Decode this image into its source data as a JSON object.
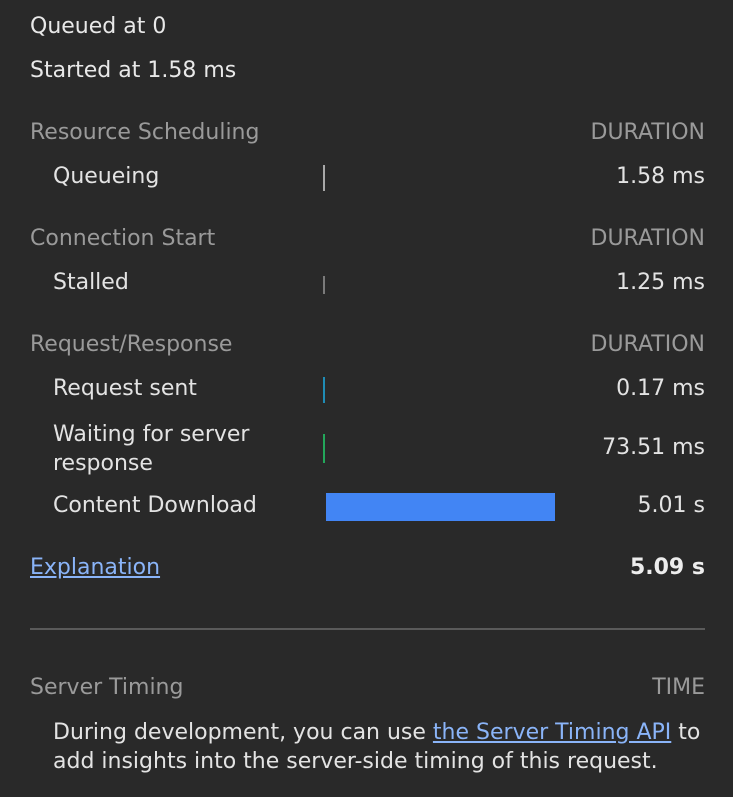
{
  "meta": {
    "queued": "Queued at 0",
    "started": "Started at 1.58 ms"
  },
  "sections": {
    "resource": {
      "title": "Resource Scheduling",
      "head": "DURATION",
      "rows": [
        {
          "label": "Queueing",
          "value": "1.58 ms",
          "bar_color": "#a8a8a8"
        }
      ]
    },
    "connection": {
      "title": "Connection Start",
      "head": "DURATION",
      "rows": [
        {
          "label": "Stalled",
          "value": "1.25 ms",
          "bar_color": "#8a8a8a"
        }
      ]
    },
    "request": {
      "title": "Request/Response",
      "head": "DURATION",
      "rows": [
        {
          "label": "Request sent",
          "value": "0.17 ms",
          "bar_color": "#1f8cb5"
        },
        {
          "label": "Waiting for server response",
          "value": "73.51 ms",
          "bar_color": "#23a65a"
        },
        {
          "label": "Content Download",
          "value": "5.01 s",
          "bar_color": "#4285f4"
        }
      ]
    }
  },
  "explanation_link": "Explanation",
  "total": "5.09 s",
  "server_timing": {
    "title": "Server Timing",
    "head": "TIME",
    "text_before": "During development, you can use ",
    "link": "the Server Timing API",
    "text_after": " to add insights into the server-side timing of this request."
  }
}
